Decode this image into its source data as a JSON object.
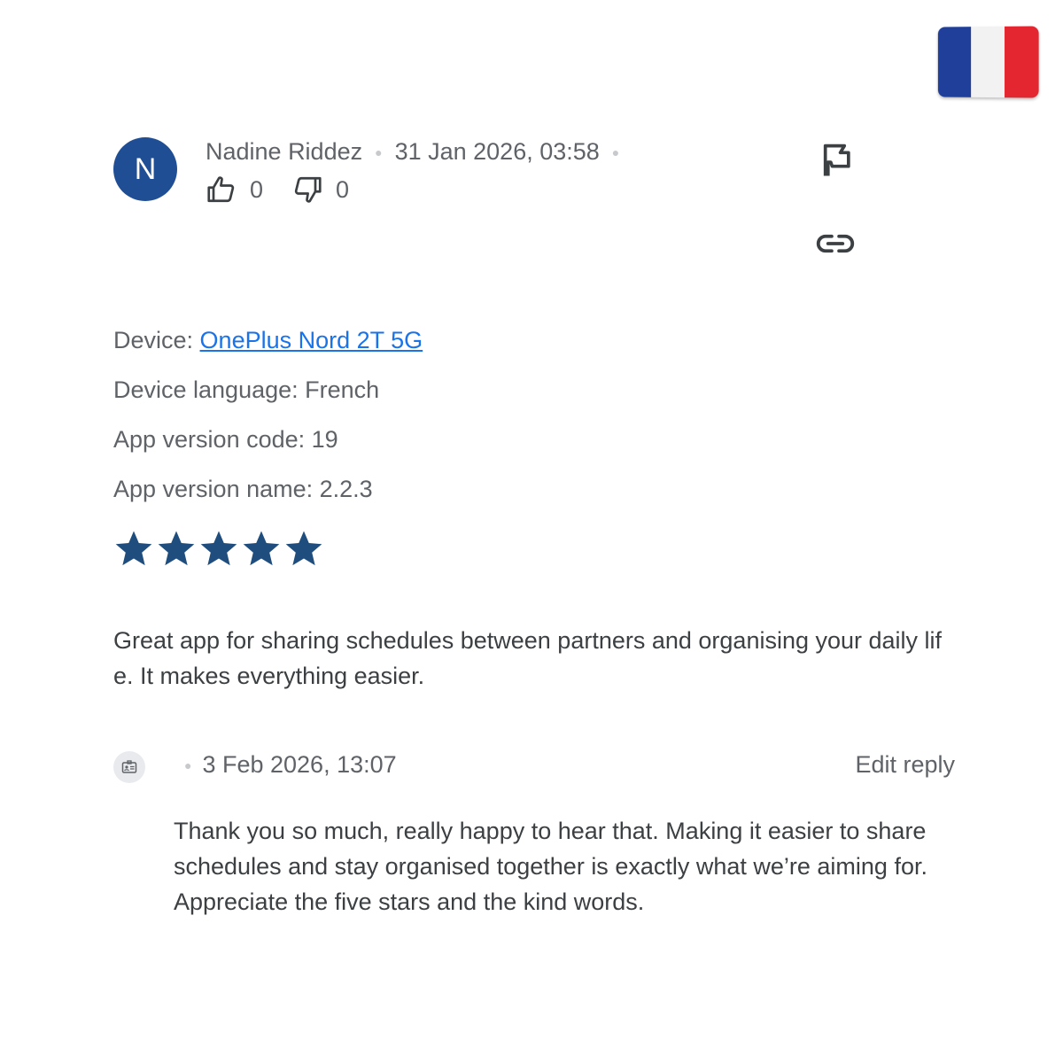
{
  "flag": {
    "country": "France",
    "colors": [
      "#1f3f9b",
      "#f2f2f2",
      "#e3262f"
    ]
  },
  "review": {
    "author_initial": "N",
    "author_name": "Nadine Riddez",
    "date": "31 Jan 2026, 03:58",
    "avatar_color": "#1f4e94",
    "thumbs_up_count": "0",
    "thumbs_down_count": "0",
    "device_label": "Device: ",
    "device_name": "OnePlus Nord 2T 5G",
    "device_language": "Device language: French",
    "app_version_code": "App version code: 19",
    "app_version_name": "App version name: 2.2.3",
    "rating": 5,
    "rating_max": 5,
    "star_color": "#1f4e7e",
    "text": "Great app for sharing schedules between partners and organising your daily life. It makes everything easier."
  },
  "reply": {
    "date": "3 Feb 2026, 13:07",
    "edit_label": "Edit reply",
    "text": "Thank you so much, really happy to hear that. Making it easier to share schedules and stay organised together is exactly what we’re aiming for. Appreciate the five stars and the kind words."
  },
  "icons": {
    "thumbs_up": "thumbs-up-icon",
    "thumbs_down": "thumbs-down-icon",
    "report": "flag-icon",
    "link": "link-icon",
    "developer": "developer-badge-icon"
  }
}
